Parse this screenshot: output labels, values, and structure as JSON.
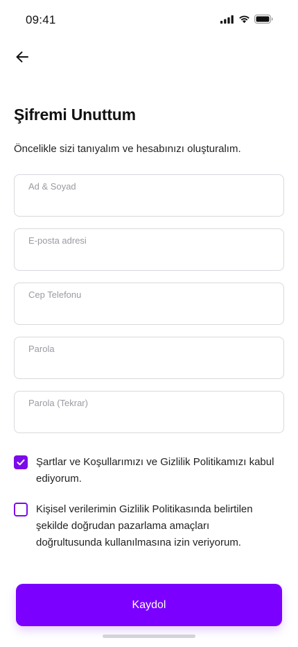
{
  "status_bar": {
    "time": "09:41"
  },
  "header": {
    "back_icon": "arrow-left-icon",
    "title": "Şifremi Unuttum",
    "subtitle": "Öncelikle sizi tanıyalım ve hesabınızı oluşturalım."
  },
  "form": {
    "fields": [
      {
        "label": "Ad & Soyad",
        "value": ""
      },
      {
        "label": "E-posta adresi",
        "value": ""
      },
      {
        "label": "Cep Telefonu",
        "value": ""
      },
      {
        "label": "Parola",
        "value": ""
      },
      {
        "label": "Parola (Tekrar)",
        "value": ""
      }
    ],
    "consents": [
      {
        "checked": true,
        "text": "Şartlar ve Koşullarımızı ve Gizlilik Politikamızı kabul ediyorum."
      },
      {
        "checked": false,
        "text": "Kişisel verilerimin Gizlilik Politikasında belirtilen şekilde doğrudan pazarlama amaçları doğrultusunda kullanılmasına izin veriyorum."
      }
    ],
    "submit_label": "Kaydol"
  },
  "colors": {
    "accent": "#7b00ff",
    "checkbox": "#7b0bea",
    "field_border": "#d9d9de",
    "placeholder_text": "#9a9aa2"
  }
}
